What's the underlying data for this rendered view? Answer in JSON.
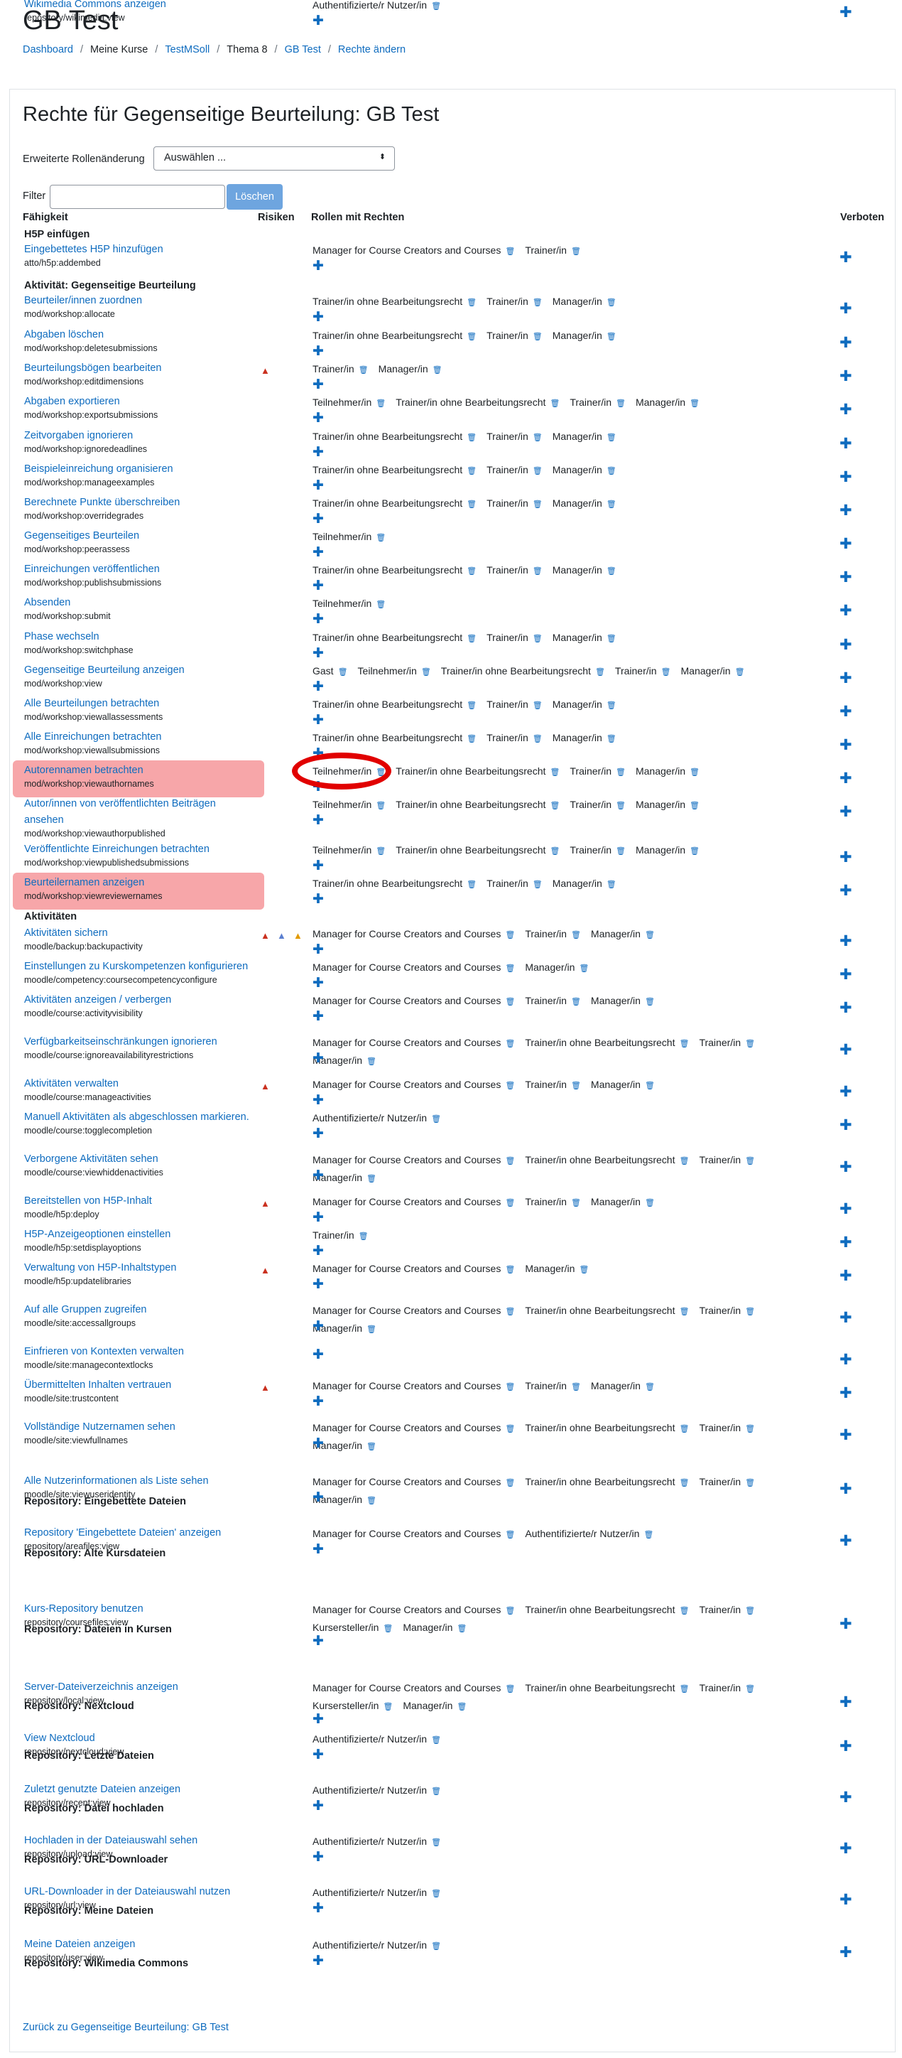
{
  "page": {
    "title": "GB Test"
  },
  "breadcrumb": [
    "Dashboard",
    "Meine Kurse",
    "TestMSoll",
    "Thema 8",
    "GB Test",
    "Rechte ändern"
  ],
  "heading": "Rechte für Gegenseitige Beurteilung: GB Test",
  "advanced_role": {
    "label": "Erweiterte Rollenänderung",
    "selected": "Auswählen ..."
  },
  "filter": {
    "label": "Filter",
    "value": "",
    "clear_label": "Löschen"
  },
  "columns": {
    "capability": "Fähigkeit",
    "risks": "Risiken",
    "roles": "Rollen mit Rechten",
    "prohibited": "Verboten"
  },
  "rows": [
    {
      "type": "section",
      "label": "H5P einfügen"
    },
    {
      "label": "Eingebettetes H5P hinzufügen",
      "code": "atto/h5p:addembed",
      "risks": [],
      "roles": [
        "Manager for Course Creators and Courses",
        "Trainer/in"
      ]
    },
    {
      "type": "section",
      "label": "Aktivität: Gegenseitige Beurteilung"
    },
    {
      "label": "Beurteiler/innen zuordnen",
      "code": "mod/workshop:allocate",
      "risks": [],
      "roles": [
        "Trainer/in ohne Bearbeitungsrecht",
        "Trainer/in",
        "Manager/in"
      ]
    },
    {
      "label": "Abgaben löschen",
      "code": "mod/workshop:deletesubmissions",
      "risks": [],
      "roles": [
        "Trainer/in ohne Bearbeitungsrecht",
        "Trainer/in",
        "Manager/in"
      ]
    },
    {
      "label": "Beurteilungsbögen bearbeiten",
      "code": "mod/workshop:editdimensions",
      "risks": [
        "red"
      ],
      "roles": [
        "Trainer/in",
        "Manager/in"
      ]
    },
    {
      "label": "Abgaben exportieren",
      "code": "mod/workshop:exportsubmissions",
      "risks": [],
      "roles": [
        "Teilnehmer/in",
        "Trainer/in ohne Bearbeitungsrecht",
        "Trainer/in",
        "Manager/in"
      ]
    },
    {
      "label": "Zeitvorgaben ignorieren",
      "code": "mod/workshop:ignoredeadlines",
      "risks": [],
      "roles": [
        "Trainer/in ohne Bearbeitungsrecht",
        "Trainer/in",
        "Manager/in"
      ]
    },
    {
      "label": "Beispieleinreichung organisieren",
      "code": "mod/workshop:manageexamples",
      "risks": [],
      "roles": [
        "Trainer/in ohne Bearbeitungsrecht",
        "Trainer/in",
        "Manager/in"
      ]
    },
    {
      "label": "Berechnete Punkte überschreiben",
      "code": "mod/workshop:overridegrades",
      "risks": [],
      "roles": [
        "Trainer/in ohne Bearbeitungsrecht",
        "Trainer/in",
        "Manager/in"
      ]
    },
    {
      "label": "Gegenseitiges Beurteilen",
      "code": "mod/workshop:peerassess",
      "risks": [],
      "roles": [
        "Teilnehmer/in"
      ]
    },
    {
      "label": "Einreichungen veröffentlichen",
      "code": "mod/workshop:publishsubmissions",
      "risks": [],
      "roles": [
        "Trainer/in ohne Bearbeitungsrecht",
        "Trainer/in",
        "Manager/in"
      ]
    },
    {
      "label": "Absenden",
      "code": "mod/workshop:submit",
      "risks": [],
      "roles": [
        "Teilnehmer/in"
      ]
    },
    {
      "label": "Phase wechseln",
      "code": "mod/workshop:switchphase",
      "risks": [],
      "roles": [
        "Trainer/in ohne Bearbeitungsrecht",
        "Trainer/in",
        "Manager/in"
      ]
    },
    {
      "label": "Gegenseitige Beurteilung anzeigen",
      "code": "mod/workshop:view",
      "risks": [],
      "roles": [
        "Gast",
        "Teilnehmer/in",
        "Trainer/in ohne Bearbeitungsrecht",
        "Trainer/in",
        "Manager/in"
      ]
    },
    {
      "label": "Alle Beurteilungen betrachten",
      "code": "mod/workshop:viewallassessments",
      "risks": [],
      "roles": [
        "Trainer/in ohne Bearbeitungsrecht",
        "Trainer/in",
        "Manager/in"
      ]
    },
    {
      "label": "Alle Einreichungen betrachten",
      "code": "mod/workshop:viewallsubmissions",
      "risks": [],
      "roles": [
        "Trainer/in ohne Bearbeitungsrecht",
        "Trainer/in",
        "Manager/in"
      ]
    },
    {
      "label": "Autorennamen betrachten",
      "code": "mod/workshop:viewauthornames",
      "risks": [],
      "roles": [
        "Teilnehmer/in",
        "Trainer/in ohne Bearbeitungsrecht",
        "Trainer/in",
        "Manager/in"
      ],
      "highlight": true
    },
    {
      "label": "Autor/innen von veröffentlichten Beiträgen ansehen",
      "code": "mod/workshop:viewauthorpublished",
      "risks": [],
      "roles": [
        "Teilnehmer/in",
        "Trainer/in ohne Bearbeitungsrecht",
        "Trainer/in",
        "Manager/in"
      ]
    },
    {
      "label": "Veröffentlichte Einreichungen betrachten",
      "code": "mod/workshop:viewpublishedsubmissions",
      "risks": [],
      "roles": [
        "Teilnehmer/in",
        "Trainer/in ohne Bearbeitungsrecht",
        "Trainer/in",
        "Manager/in"
      ]
    },
    {
      "label": "Beurteilernamen anzeigen",
      "code": "mod/workshop:viewreviewernames",
      "risks": [],
      "roles": [
        "Trainer/in ohne Bearbeitungsrecht",
        "Trainer/in",
        "Manager/in"
      ],
      "highlight": true
    },
    {
      "type": "section",
      "label": "Aktivitäten"
    },
    {
      "label": "Aktivitäten sichern",
      "code": "moodle/backup:backupactivity",
      "risks": [
        "red",
        "blue",
        "orange"
      ],
      "roles": [
        "Manager for Course Creators and Courses",
        "Trainer/in",
        "Manager/in"
      ]
    },
    {
      "label": "Einstellungen zu Kurskompetenzen konfigurieren",
      "code": "moodle/competency:coursecompetencyconfigure",
      "risks": [],
      "roles": [
        "Manager for Course Creators and Courses",
        "Manager/in"
      ]
    },
    {
      "label": "Aktivitäten anzeigen / verbergen",
      "code": "moodle/course:activityvisibility",
      "risks": [],
      "roles": [
        "Manager for Course Creators and Courses",
        "Trainer/in",
        "Manager/in"
      ]
    },
    {
      "label": "Verfügbarkeitseinschränkungen ignorieren",
      "code": "moodle/course:ignoreavailabilityrestrictions",
      "risks": [],
      "roles": [
        "Manager for Course Creators and Courses",
        "Trainer/in ohne Bearbeitungsrecht",
        "Trainer/in",
        "Manager/in"
      ]
    },
    {
      "label": "Aktivitäten verwalten",
      "code": "moodle/course:manageactivities",
      "risks": [
        "red"
      ],
      "roles": [
        "Manager for Course Creators and Courses",
        "Trainer/in",
        "Manager/in"
      ]
    },
    {
      "label": "Manuell Aktivitäten als abgeschlossen markieren.",
      "code": "moodle/course:togglecompletion",
      "risks": [],
      "roles": [
        "Authentifizierte/r Nutzer/in"
      ]
    },
    {
      "label": "Verborgene Aktivitäten sehen",
      "code": "moodle/course:viewhiddenactivities",
      "risks": [],
      "roles": [
        "Manager for Course Creators and Courses",
        "Trainer/in ohne Bearbeitungsrecht",
        "Trainer/in",
        "Manager/in"
      ]
    },
    {
      "label": "Bereitstellen von H5P-Inhalt",
      "code": "moodle/h5p:deploy",
      "risks": [
        "red"
      ],
      "roles": [
        "Manager for Course Creators and Courses",
        "Trainer/in",
        "Manager/in"
      ]
    },
    {
      "label": "H5P-Anzeigeoptionen einstellen",
      "code": "moodle/h5p:setdisplayoptions",
      "risks": [],
      "roles": [
        "Trainer/in"
      ]
    },
    {
      "label": "Verwaltung von H5P-Inhaltstypen",
      "code": "moodle/h5p:updatelibraries",
      "risks": [
        "red"
      ],
      "roles": [
        "Manager for Course Creators and Courses",
        "Manager/in"
      ]
    },
    {
      "label": "Auf alle Gruppen zugreifen",
      "code": "moodle/site:accessallgroups",
      "risks": [],
      "roles": [
        "Manager for Course Creators and Courses",
        "Trainer/in ohne Bearbeitungsrecht",
        "Trainer/in",
        "Manager/in"
      ]
    },
    {
      "label": "Einfrieren von Kontexten verwalten",
      "code": "moodle/site:managecontextlocks",
      "risks": [],
      "roles": []
    },
    {
      "label": "Übermittelten Inhalten vertrauen",
      "code": "moodle/site:trustcontent",
      "risks": [
        "red"
      ],
      "roles": [
        "Manager for Course Creators and Courses",
        "Trainer/in",
        "Manager/in"
      ]
    },
    {
      "label": "Vollständige Nutzernamen sehen",
      "code": "moodle/site:viewfullnames",
      "risks": [],
      "roles": [
        "Manager for Course Creators and Courses",
        "Trainer/in ohne Bearbeitungsrecht",
        "Trainer/in",
        "Manager/in"
      ]
    },
    {
      "label": "Alle Nutzerinformationen als Liste sehen",
      "code": "moodle/site:viewuseridentity",
      "risks": [],
      "roles": [
        "Manager for Course Creators and Courses",
        "Trainer/in ohne Bearbeitungsrecht",
        "Trainer/in",
        "Manager/in"
      ]
    },
    {
      "type": "section",
      "label": "Repository: Eingebettete Dateien"
    },
    {
      "label": "Repository 'Eingebettete Dateien' anzeigen",
      "code": "repository/areafiles:view",
      "risks": [],
      "roles": [
        "Manager for Course Creators and Courses",
        "Authentifizierte/r Nutzer/in"
      ]
    },
    {
      "type": "section",
      "label": "Repository: Alte Kursdateien"
    },
    {
      "label": "Kurs-Repository benutzen",
      "code": "repository/coursefiles:view",
      "risks": [],
      "roles": [
        "Manager for Course Creators and Courses",
        "Trainer/in ohne Bearbeitungsrecht",
        "Trainer/in",
        "Kursersteller/in",
        "Manager/in"
      ]
    },
    {
      "type": "section",
      "label": "Repository: Dateien in Kursen"
    },
    {
      "label": "Server-Dateiverzeichnis anzeigen",
      "code": "repository/local:view",
      "risks": [],
      "roles": [
        "Manager for Course Creators and Courses",
        "Trainer/in ohne Bearbeitungsrecht",
        "Trainer/in",
        "Kursersteller/in",
        "Manager/in"
      ]
    },
    {
      "type": "section",
      "label": "Repository: Nextcloud"
    },
    {
      "label": "View Nextcloud",
      "code": "repository/nextcloud:view",
      "risks": [],
      "roles": [
        "Authentifizierte/r Nutzer/in"
      ]
    },
    {
      "type": "section",
      "label": "Repository: Letzte Dateien"
    },
    {
      "label": "Zuletzt genutzte Dateien anzeigen",
      "code": "repository/recent:view",
      "risks": [],
      "roles": [
        "Authentifizierte/r Nutzer/in"
      ]
    },
    {
      "type": "section",
      "label": "Repository: Datei hochladen"
    },
    {
      "label": "Hochladen in der Dateiauswahl sehen",
      "code": "repository/upload:view",
      "risks": [],
      "roles": [
        "Authentifizierte/r Nutzer/in"
      ]
    },
    {
      "type": "section",
      "label": "Repository: URL-Downloader"
    },
    {
      "label": "URL-Downloader in der Dateiauswahl nutzen",
      "code": "repository/url:view",
      "risks": [],
      "roles": [
        "Authentifizierte/r Nutzer/in"
      ]
    },
    {
      "type": "section",
      "label": "Repository: Meine Dateien"
    },
    {
      "label": "Meine Dateien anzeigen",
      "code": "repository/user:view",
      "risks": [],
      "roles": [
        "Authentifizierte/r Nutzer/in"
      ]
    },
    {
      "type": "section",
      "label": "Repository: Wikimedia Commons"
    },
    {
      "label": "Wikimedia Commons anzeigen",
      "code": "repository/wikimedia:view",
      "risks": [],
      "roles": [
        "Authentifizierte/r Nutzer/in"
      ]
    }
  ],
  "back_link": "Zurück zu Gegenseitige Beurteilung: GB Test",
  "colors": {
    "link": "#0f6cbf",
    "highlight": "#f7a1a4",
    "annotation": "#e10000"
  },
  "icons": {
    "delete": "trash-icon",
    "add": "plus-icon",
    "prohibit": "plus-icon",
    "risk": "warning-triangle-icon"
  }
}
